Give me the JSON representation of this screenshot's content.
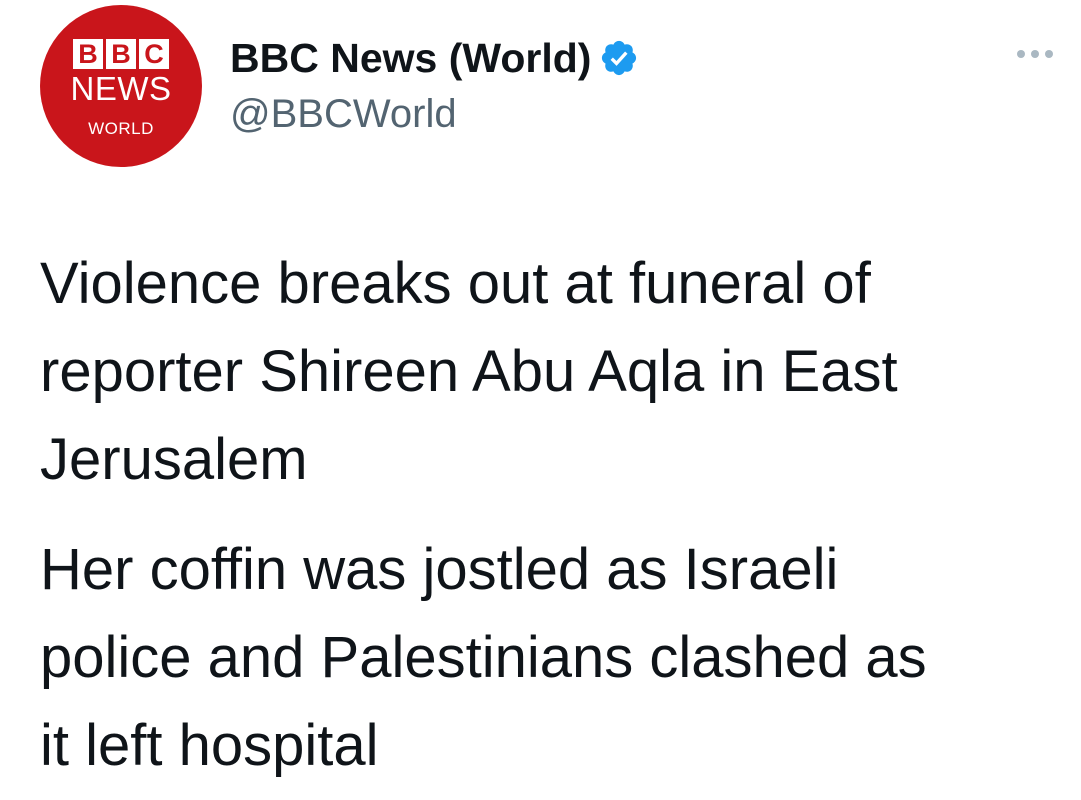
{
  "account": {
    "avatar": {
      "brand_letters": [
        "B",
        "B",
        "C"
      ],
      "line1": "NEWS",
      "line2": "WORLD",
      "background_color": "#c9151b"
    },
    "display_name": "BBC News (World)",
    "verified_icon": "verified-badge-icon",
    "verified_color": "#1d9bf0",
    "handle": "@BBCWorld"
  },
  "menu": {
    "icon": "more-options-icon"
  },
  "tweet": {
    "paragraphs": [
      "Violence breaks out at funeral of\nreporter Shireen Abu Aqla in East\nJerusalem",
      "Her coffin was jostled as Israeli\npolice and Palestinians clashed as\nit left hospital"
    ]
  }
}
